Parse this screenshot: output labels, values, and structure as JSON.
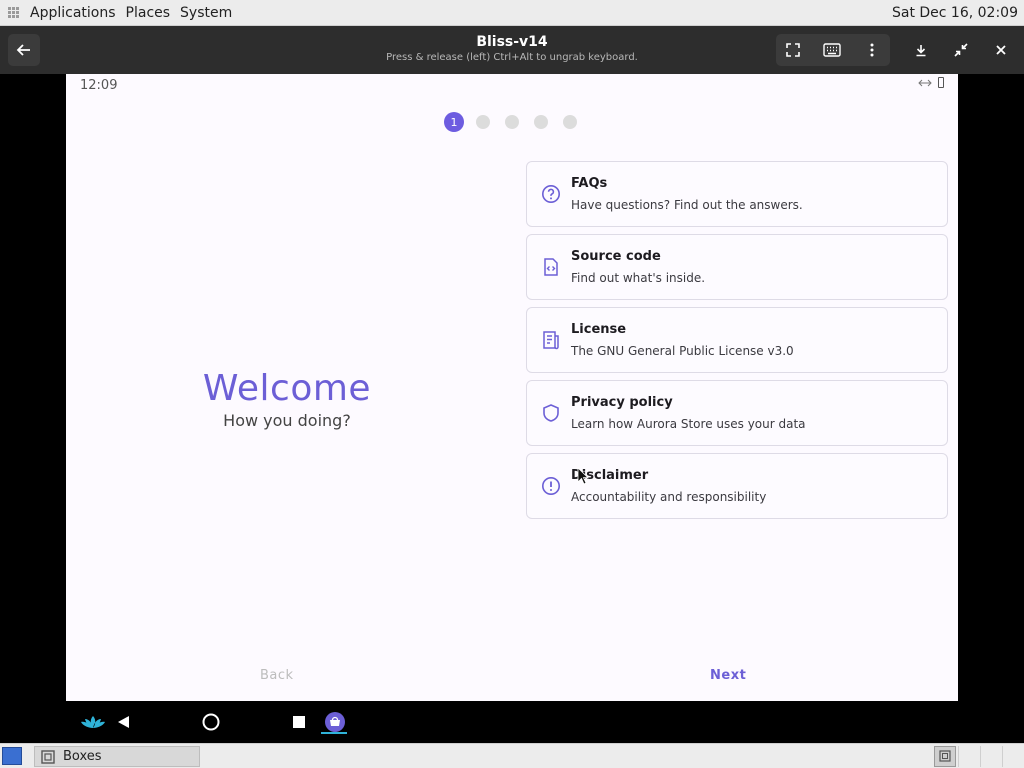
{
  "topbar": {
    "menus": [
      "Applications",
      "Places",
      "System"
    ],
    "clock": "Sat Dec 16, 02:09"
  },
  "header": {
    "title": "Bliss-v14",
    "subtitle": "Press & release (left) Ctrl+Alt to ungrab keyboard."
  },
  "android": {
    "status_time": "12:09",
    "steps": [
      "1",
      "",
      "",
      "",
      ""
    ],
    "welcome_title": "Welcome",
    "welcome_subtitle": "How you doing?",
    "cards": [
      {
        "icon": "question-circle-icon",
        "title": "FAQs",
        "desc": "Have questions? Find out the answers."
      },
      {
        "icon": "source-code-icon",
        "title": "Source code",
        "desc": "Find out what's inside."
      },
      {
        "icon": "license-document-icon",
        "title": "License",
        "desc": "The GNU General Public License v3.0"
      },
      {
        "icon": "shield-icon",
        "title": "Privacy policy",
        "desc": "Learn how Aurora Store uses your data"
      },
      {
        "icon": "exclamation-circle-icon",
        "title": "Disclaimer",
        "desc": "Accountability and responsibility"
      }
    ],
    "back_label": "Back",
    "next_label": "Next",
    "accent": "#6c5fd6"
  },
  "taskbar": {
    "task_label": "Boxes"
  }
}
